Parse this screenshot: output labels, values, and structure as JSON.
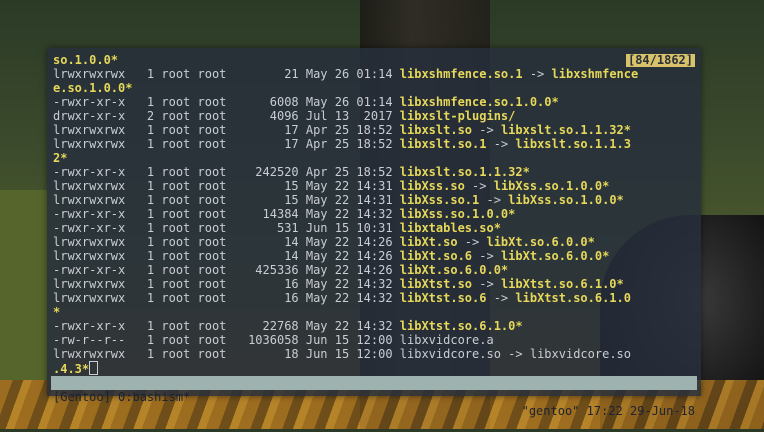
{
  "terminal": {
    "counter": "[84/1862]",
    "status_left": "[Gentoo] 0:bashism*",
    "status_right": "\"gentoo\" 17:22 29-Jun-18",
    "lines": [
      {
        "t": "n",
        "text": "so.1.0.0*"
      },
      {
        "t": "e",
        "meta": "lrwxrwxrwx   1 root root        21 May 26 01:14 ",
        "name": "libxshmfence.so.1",
        "arrow": " -> ",
        "target": "libxshmfence"
      },
      {
        "t": "n",
        "text": "e.so.1.0.0*"
      },
      {
        "t": "e",
        "meta": "-rwxr-xr-x   1 root root      6008 May 26 01:14 ",
        "name": "libxshmfence.so.1.0.0*"
      },
      {
        "t": "e",
        "meta": "drwxr-xr-x   2 root root      4096 Jul 13  2017 ",
        "name": "libxslt-plugins/"
      },
      {
        "t": "e",
        "meta": "lrwxrwxrwx   1 root root        17 Apr 25 18:52 ",
        "name": "libxslt.so",
        "arrow": " -> ",
        "target": "libxslt.so.1.1.32*"
      },
      {
        "t": "e",
        "meta": "lrwxrwxrwx   1 root root        17 Apr 25 18:52 ",
        "name": "libxslt.so.1",
        "arrow": " -> ",
        "target": "libxslt.so.1.1.3"
      },
      {
        "t": "n",
        "text": "2*"
      },
      {
        "t": "e",
        "meta": "-rwxr-xr-x   1 root root    242520 Apr 25 18:52 ",
        "name": "libxslt.so.1.1.32*"
      },
      {
        "t": "e",
        "meta": "lrwxrwxrwx   1 root root        15 May 22 14:31 ",
        "name": "libXss.so",
        "arrow": " -> ",
        "target": "libXss.so.1.0.0*"
      },
      {
        "t": "e",
        "meta": "lrwxrwxrwx   1 root root        15 May 22 14:31 ",
        "name": "libXss.so.1",
        "arrow": " -> ",
        "target": "libXss.so.1.0.0*"
      },
      {
        "t": "e",
        "meta": "-rwxr-xr-x   1 root root     14384 May 22 14:32 ",
        "name": "libXss.so.1.0.0*"
      },
      {
        "t": "e",
        "meta": "-rwxr-xr-x   1 root root       531 Jun 15 10:31 ",
        "name": "libxtables.so*"
      },
      {
        "t": "e",
        "meta": "lrwxrwxrwx   1 root root        14 May 22 14:26 ",
        "name": "libXt.so",
        "arrow": " -> ",
        "target": "libXt.so.6.0.0*"
      },
      {
        "t": "e",
        "meta": "lrwxrwxrwx   1 root root        14 May 22 14:26 ",
        "name": "libXt.so.6",
        "arrow": " -> ",
        "target": "libXt.so.6.0.0*"
      },
      {
        "t": "e",
        "meta": "-rwxr-xr-x   1 root root    425336 May 22 14:26 ",
        "name": "libXt.so.6.0.0*"
      },
      {
        "t": "e",
        "meta": "lrwxrwxrwx   1 root root        16 May 22 14:32 ",
        "name": "libXtst.so",
        "arrow": " -> ",
        "target": "libXtst.so.6.1.0*"
      },
      {
        "t": "e",
        "meta": "lrwxrwxrwx   1 root root        16 May 22 14:32 ",
        "name": "libXtst.so.6",
        "arrow": " -> ",
        "target": "libXtst.so.6.1.0"
      },
      {
        "t": "n",
        "text": "*"
      },
      {
        "t": "e",
        "meta": "-rwxr-xr-x   1 root root     22768 May 22 14:32 ",
        "name": "libXtst.so.6.1.0*"
      },
      {
        "t": "e",
        "meta": "-rw-r--r--   1 root root   1036058 Jun 15 12:00 ",
        "name": "libxvidcore.a",
        "plain": true
      },
      {
        "t": "e",
        "meta": "lrwxrwxrwx   1 root root        18 Jun 15 12:00 ",
        "name": "libxvidcore.so",
        "plain": true,
        "arrow": " -> ",
        "target": "libxvidcore.so"
      },
      {
        "t": "c",
        "text": ".4.3*"
      }
    ]
  }
}
